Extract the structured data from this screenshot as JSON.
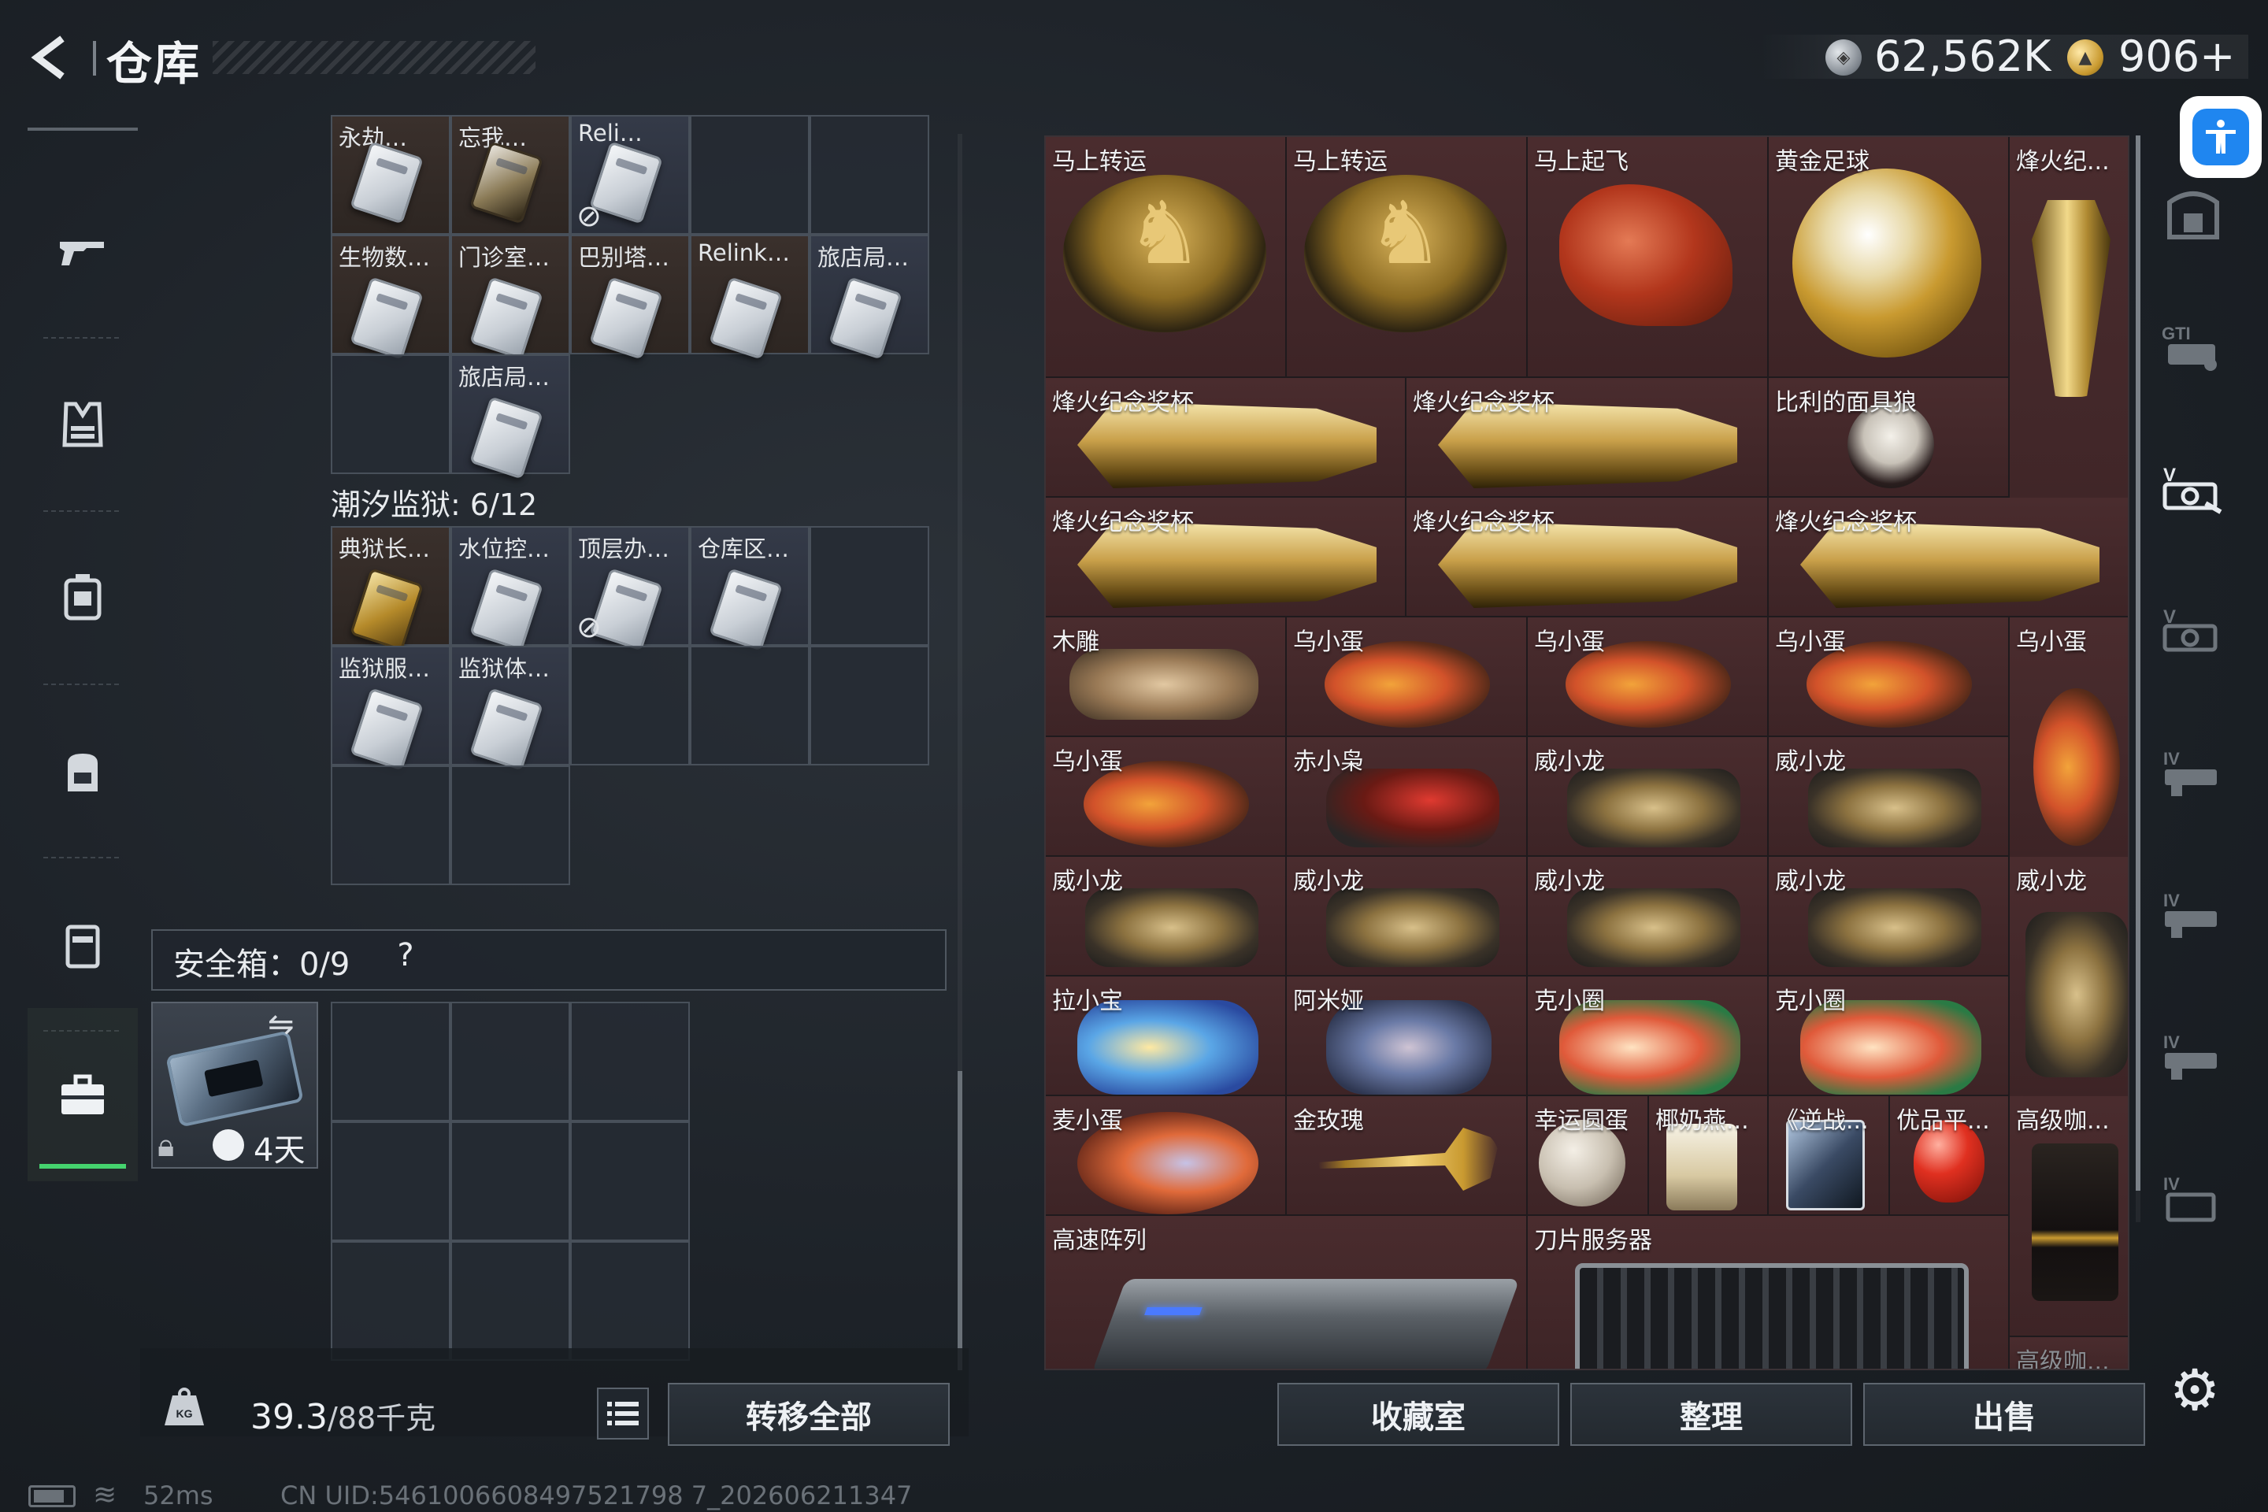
{
  "header": {
    "title": "仓库",
    "silver_amount": "62,562K",
    "gold_amount": "906+"
  },
  "left_nav": {
    "items": [
      {
        "icon": "gun-icon",
        "name": "weapons"
      },
      {
        "icon": "armor-vest-icon",
        "name": "armor"
      },
      {
        "icon": "rig-icon",
        "name": "chest-rig"
      },
      {
        "icon": "backpack-icon",
        "name": "backpack"
      },
      {
        "icon": "pouch-icon",
        "name": "pouch"
      },
      {
        "icon": "toolbox-icon",
        "name": "storage",
        "active": true
      }
    ]
  },
  "inventory": {
    "top_row_labels": [
      "永劫…",
      "忘我…",
      "Reli…"
    ],
    "row2_labels": [
      "生物数…",
      "门诊室…",
      "巴别塔…",
      "Relink…",
      "旅店局…"
    ],
    "row3_labels": [
      "旅店局…"
    ],
    "section_title": "潮汐监狱: 6/12",
    "section_row1": [
      "典狱长…",
      "水位控…",
      "顶层办…",
      "仓库区…"
    ],
    "section_row2": [
      "监狱服…",
      "监狱体…"
    ]
  },
  "safe_box": {
    "label": "安全箱：0/9",
    "help": "?",
    "timer": "4天"
  },
  "bottom_left": {
    "weight_current": "39.3",
    "weight_max": "/88千克",
    "transfer_all_label": "转移全部"
  },
  "warehouse": {
    "labels": {
      "r0c0": "马上转运",
      "r0c1": "马上转运",
      "r0c2": "马上起飞",
      "r0c3": "黄金足球",
      "r0c4": "烽火纪...",
      "r1a": "烽火纪念奖杯",
      "r1b": "烽火纪念奖杯",
      "r1c": "比利的面具狼",
      "r2a": "烽火纪念奖杯",
      "r2b": "烽火纪念奖杯",
      "r2c": "烽火纪念奖杯",
      "r3c0": "木雕",
      "r3c1": "乌小蛋",
      "r3c2": "乌小蛋",
      "r3c3": "乌小蛋",
      "r3c4": "乌小蛋",
      "r4c0": "乌小蛋",
      "r4c1": "赤小枭",
      "r4c2": "威小龙",
      "r4c3": "威小龙",
      "r5c0": "威小龙",
      "r5c1": "威小龙",
      "r5c2": "威小龙",
      "r5c3": "威小龙",
      "r5c4": "威小龙",
      "r6c0": "拉小宝",
      "r6c1": "阿米娅",
      "r6c2": "克小圈",
      "r6c3": "克小圈",
      "r7c0": "麦小蛋",
      "r7c1": "金玫瑰",
      "r7c2": "幸运圆蛋",
      "r7c2b": "椰奶燕...",
      "r7c3": "《逆战...",
      "r7c3b": "优品平...",
      "r7c4": "高级咖...",
      "r8a": "高速阵列",
      "r8b": "刀片服务器",
      "r8c": "高级咖..."
    }
  },
  "side_tabs": [
    "storage-cabinet",
    "GTI",
    "V",
    "V",
    "IV",
    "IV",
    "IV",
    "IV",
    "IV"
  ],
  "bottom_right": {
    "collection_label": "收藏室",
    "organize_label": "整理",
    "sell_label": "出售"
  },
  "status": {
    "ping": "52ms",
    "uid": "CN UID:5461006608497521798 7_202606211347"
  },
  "colors": {
    "accent_active": "#45d36e",
    "cell_red": "#4a2c2e",
    "access_blue": "#1f86f0"
  }
}
